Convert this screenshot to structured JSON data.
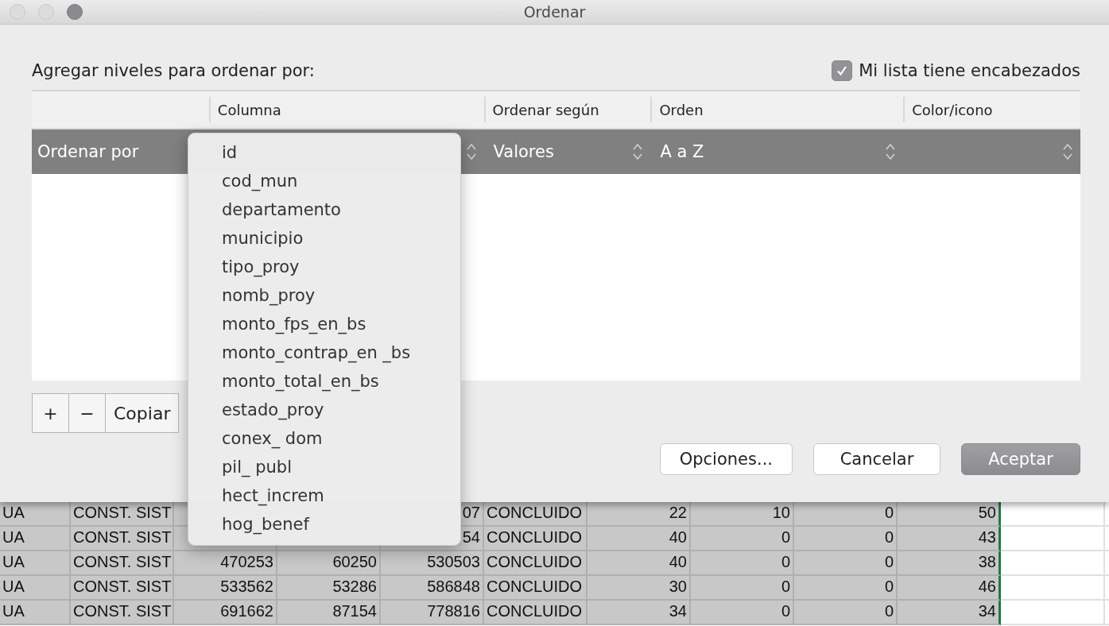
{
  "window": {
    "title": "Ordenar"
  },
  "heading": "Agregar niveles para ordenar por:",
  "headers_checkbox": {
    "label": "Mi lista tiene encabezados",
    "checked": true
  },
  "table": {
    "columns": [
      "Columna",
      "Ordenar según",
      "Orden",
      "Color/icono"
    ],
    "levels": [
      {
        "label": "Ordenar por",
        "sort_on": "Valores",
        "order": "A a Z",
        "selected": true
      }
    ]
  },
  "level_buttons": [
    "+",
    "−",
    "Copiar"
  ],
  "buttons": [
    {
      "label": "Opciones...",
      "kind": "normal"
    },
    {
      "label": "Cancelar",
      "kind": "normal"
    },
    {
      "label": "Aceptar",
      "kind": "default"
    }
  ],
  "dropdown": {
    "items": [
      {
        "label": "id",
        "selected": false
      },
      {
        "label": "cod_mun",
        "selected": false
      },
      {
        "label": "departamento",
        "selected": false
      },
      {
        "label": "municipio",
        "selected": false
      },
      {
        "label": "tipo_proy",
        "selected": false
      },
      {
        "label": "nomb_proy",
        "selected": false
      },
      {
        "label": "monto_fps_en_bs",
        "selected": false
      },
      {
        "label": "monto_contrap_en _bs",
        "selected": false
      },
      {
        "label": "monto_total_en_bs",
        "selected": false
      },
      {
        "label": "estado_proy",
        "selected": false
      },
      {
        "label": "conex_ dom",
        "selected": false
      },
      {
        "label": "pil_ publ",
        "selected": false
      },
      {
        "label": "hect_increm",
        "selected": false
      },
      {
        "label": "hog_benef",
        "selected": false
      }
    ]
  },
  "sheet": {
    "columns": [
      {
        "kind": "text",
        "selected": true
      },
      {
        "kind": "text",
        "selected": true
      },
      {
        "kind": "number",
        "selected": true
      },
      {
        "kind": "number",
        "selected": true
      },
      {
        "kind": "number",
        "selected": true
      },
      {
        "kind": "text",
        "selected": true
      },
      {
        "kind": "number",
        "selected": true
      },
      {
        "kind": "number",
        "selected": true
      },
      {
        "kind": "number",
        "selected": true
      },
      {
        "kind": "number",
        "selected": true
      },
      {
        "kind": "text",
        "selected": false
      },
      {
        "kind": "text",
        "selected": false
      }
    ],
    "rows": [
      [
        "UA",
        "CONST. SIST",
        null,
        null,
        "07",
        "CONCLUIDO",
        "22",
        "10",
        "0",
        "50",
        null,
        null
      ],
      [
        "UA",
        "CONST. SIST",
        null,
        null,
        "54",
        "CONCLUIDO",
        "40",
        "0",
        "0",
        "43",
        null,
        null
      ],
      [
        "UA",
        "CONST. SIST",
        "470253",
        "60250",
        "530503",
        "CONCLUIDO",
        "40",
        "0",
        "0",
        "38",
        null,
        null
      ],
      [
        "UA",
        "CONST. SIST",
        "533562",
        "53286",
        "586848",
        "CONCLUIDO",
        "30",
        "0",
        "0",
        "46",
        null,
        null
      ],
      [
        "UA",
        "CONST. SIST",
        "691662",
        "87154",
        "778816",
        "CONCLUIDO",
        "34",
        "0",
        "0",
        "34",
        null,
        null
      ]
    ]
  }
}
